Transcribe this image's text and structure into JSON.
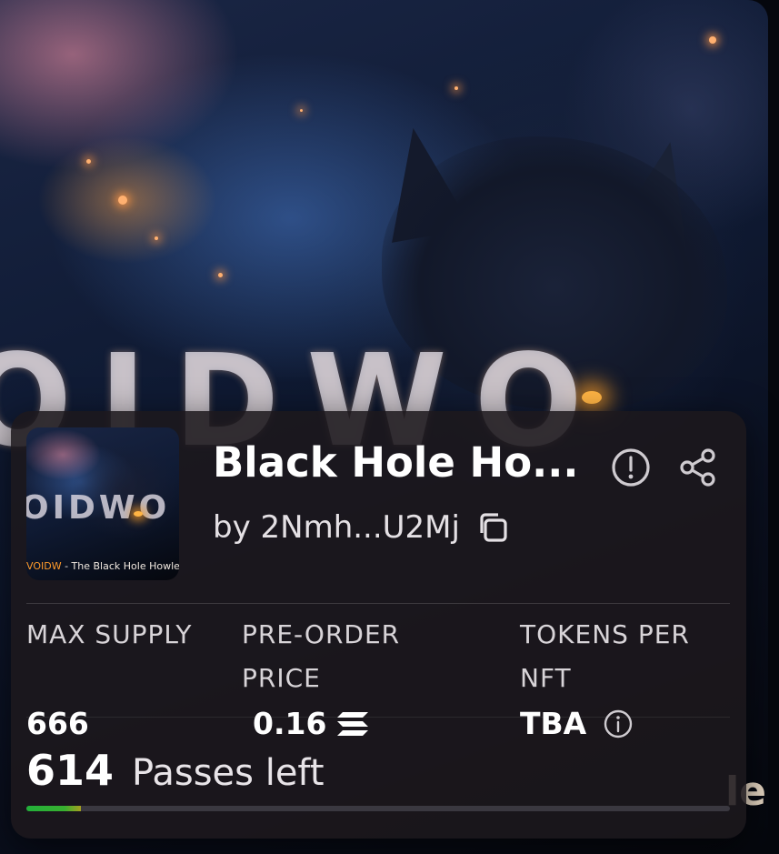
{
  "hero": {
    "background_word": "OIDWO",
    "edge_text": "le"
  },
  "card": {
    "thumbnail": {
      "word": "OIDWO",
      "caption_prefix": "VOIDW",
      "caption_rest": " - The Black Hole Howler"
    },
    "title": "Black Hole Ho...",
    "creator": "by 2Nmh...U2Mj",
    "icons": {
      "info": "info-circle-icon",
      "share": "share-icon",
      "copy": "copy-icon",
      "currency": "solana-icon",
      "tba_info": "info-circle-icon"
    },
    "stats": [
      {
        "label": "MAX SUPPLY",
        "value": "666"
      },
      {
        "label": "PRE-ORDER PRICE",
        "value": "0.16"
      },
      {
        "label": "TOKENS PER NFT",
        "value": "TBA"
      }
    ],
    "passes_left": "614",
    "passes_label": "Passes left",
    "progress_fraction": 0.078,
    "colors": {
      "progress_fill": "#22b03a",
      "progress_track": "#3a3840",
      "card_bg": "#1c181c"
    }
  }
}
